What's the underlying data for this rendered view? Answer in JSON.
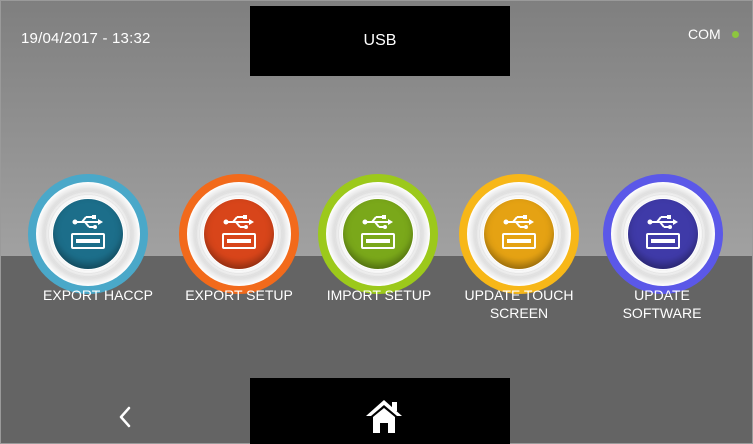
{
  "header": {
    "datetime": "19/04/2017 - 13:32",
    "title": "USB",
    "com_label": "COM",
    "com_status_color": "#8dc63f"
  },
  "buttons": [
    {
      "label": "EXPORT HACCP",
      "icon": "usb-icon",
      "color": "#1c6e8a",
      "ring": "#4aa8c9"
    },
    {
      "label": "EXPORT SETUP",
      "icon": "usb-icon",
      "color": "#d8451a",
      "ring": "#f26a1b"
    },
    {
      "label": "IMPORT SETUP",
      "icon": "usb-icon",
      "color": "#7aa81a",
      "ring": "#9cc91b"
    },
    {
      "label_line1": "UPDATE TOUCH",
      "label_line2": "SCREEN",
      "icon": "usb-icon",
      "color": "#e5a213",
      "ring": "#f7b718"
    },
    {
      "label_line1": "UPDATE",
      "label_line2": "SOFTWARE",
      "icon": "usb-icon",
      "color": "#3f3aa8",
      "ring": "#5b58e8"
    }
  ],
  "nav": {
    "back_icon": "chevron-left-icon",
    "home_icon": "home-icon"
  }
}
